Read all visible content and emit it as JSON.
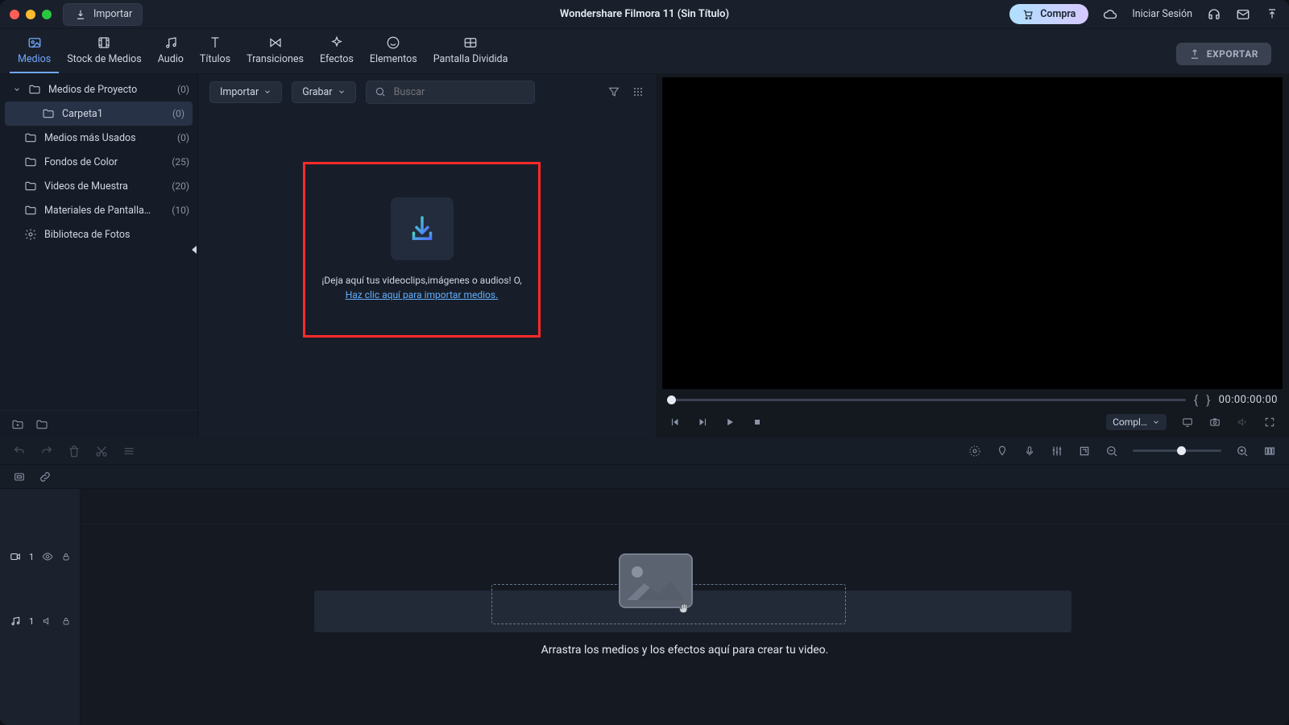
{
  "titlebar": {
    "import_btn": "Importar",
    "title": "Wondershare Filmora 11 (Sin Título)",
    "buy": "Compra",
    "login": "Iniciar Sesión"
  },
  "modules": {
    "items": [
      {
        "label": "Medios",
        "icon": "image-icon"
      },
      {
        "label": "Stock de Medios",
        "icon": "film-icon"
      },
      {
        "label": "Audio",
        "icon": "music-icon"
      },
      {
        "label": "Títulos",
        "icon": "text-icon"
      },
      {
        "label": "Transiciones",
        "icon": "transition-icon"
      },
      {
        "label": "Efectos",
        "icon": "sparkle-icon"
      },
      {
        "label": "Elementos",
        "icon": "smile-icon"
      },
      {
        "label": "Pantalla Dividida",
        "icon": "split-icon"
      }
    ],
    "export": "EXPORTAR"
  },
  "sidebar": {
    "items": [
      {
        "label": "Medios de Proyecto",
        "count": "(0)",
        "kind": "folder",
        "expandable": true
      },
      {
        "label": "Carpeta1",
        "count": "(0)",
        "kind": "folder",
        "indent": true,
        "selected": true
      },
      {
        "label": "Medios más Usados",
        "count": "(0)",
        "kind": "folder"
      },
      {
        "label": "Fondos de Color",
        "count": "(25)",
        "kind": "folder"
      },
      {
        "label": "Videos de Muestra",
        "count": "(20)",
        "kind": "folder"
      },
      {
        "label": "Materiales de Pantalla…",
        "count": "(10)",
        "kind": "folder"
      },
      {
        "label": "Biblioteca de Fotos",
        "count": "",
        "kind": "gear"
      }
    ]
  },
  "media_toolbar": {
    "import": "Importar",
    "record": "Grabar",
    "search_placeholder": "Buscar"
  },
  "dropzone": {
    "line1": "¡Deja aquí tus videoclips,imágenes o audios! O,",
    "link": "Haz clic aquí para importar medios."
  },
  "preview": {
    "time": "00:00:00:00",
    "quality": "Compl…"
  },
  "timeline": {
    "hint": "Arrastra los medios y los efectos aquí para crear tu video.",
    "video_track": "1",
    "audio_track": "1"
  },
  "colors": {
    "highlight_box": "#ff2a2a",
    "accent": "#6fa8ff"
  }
}
